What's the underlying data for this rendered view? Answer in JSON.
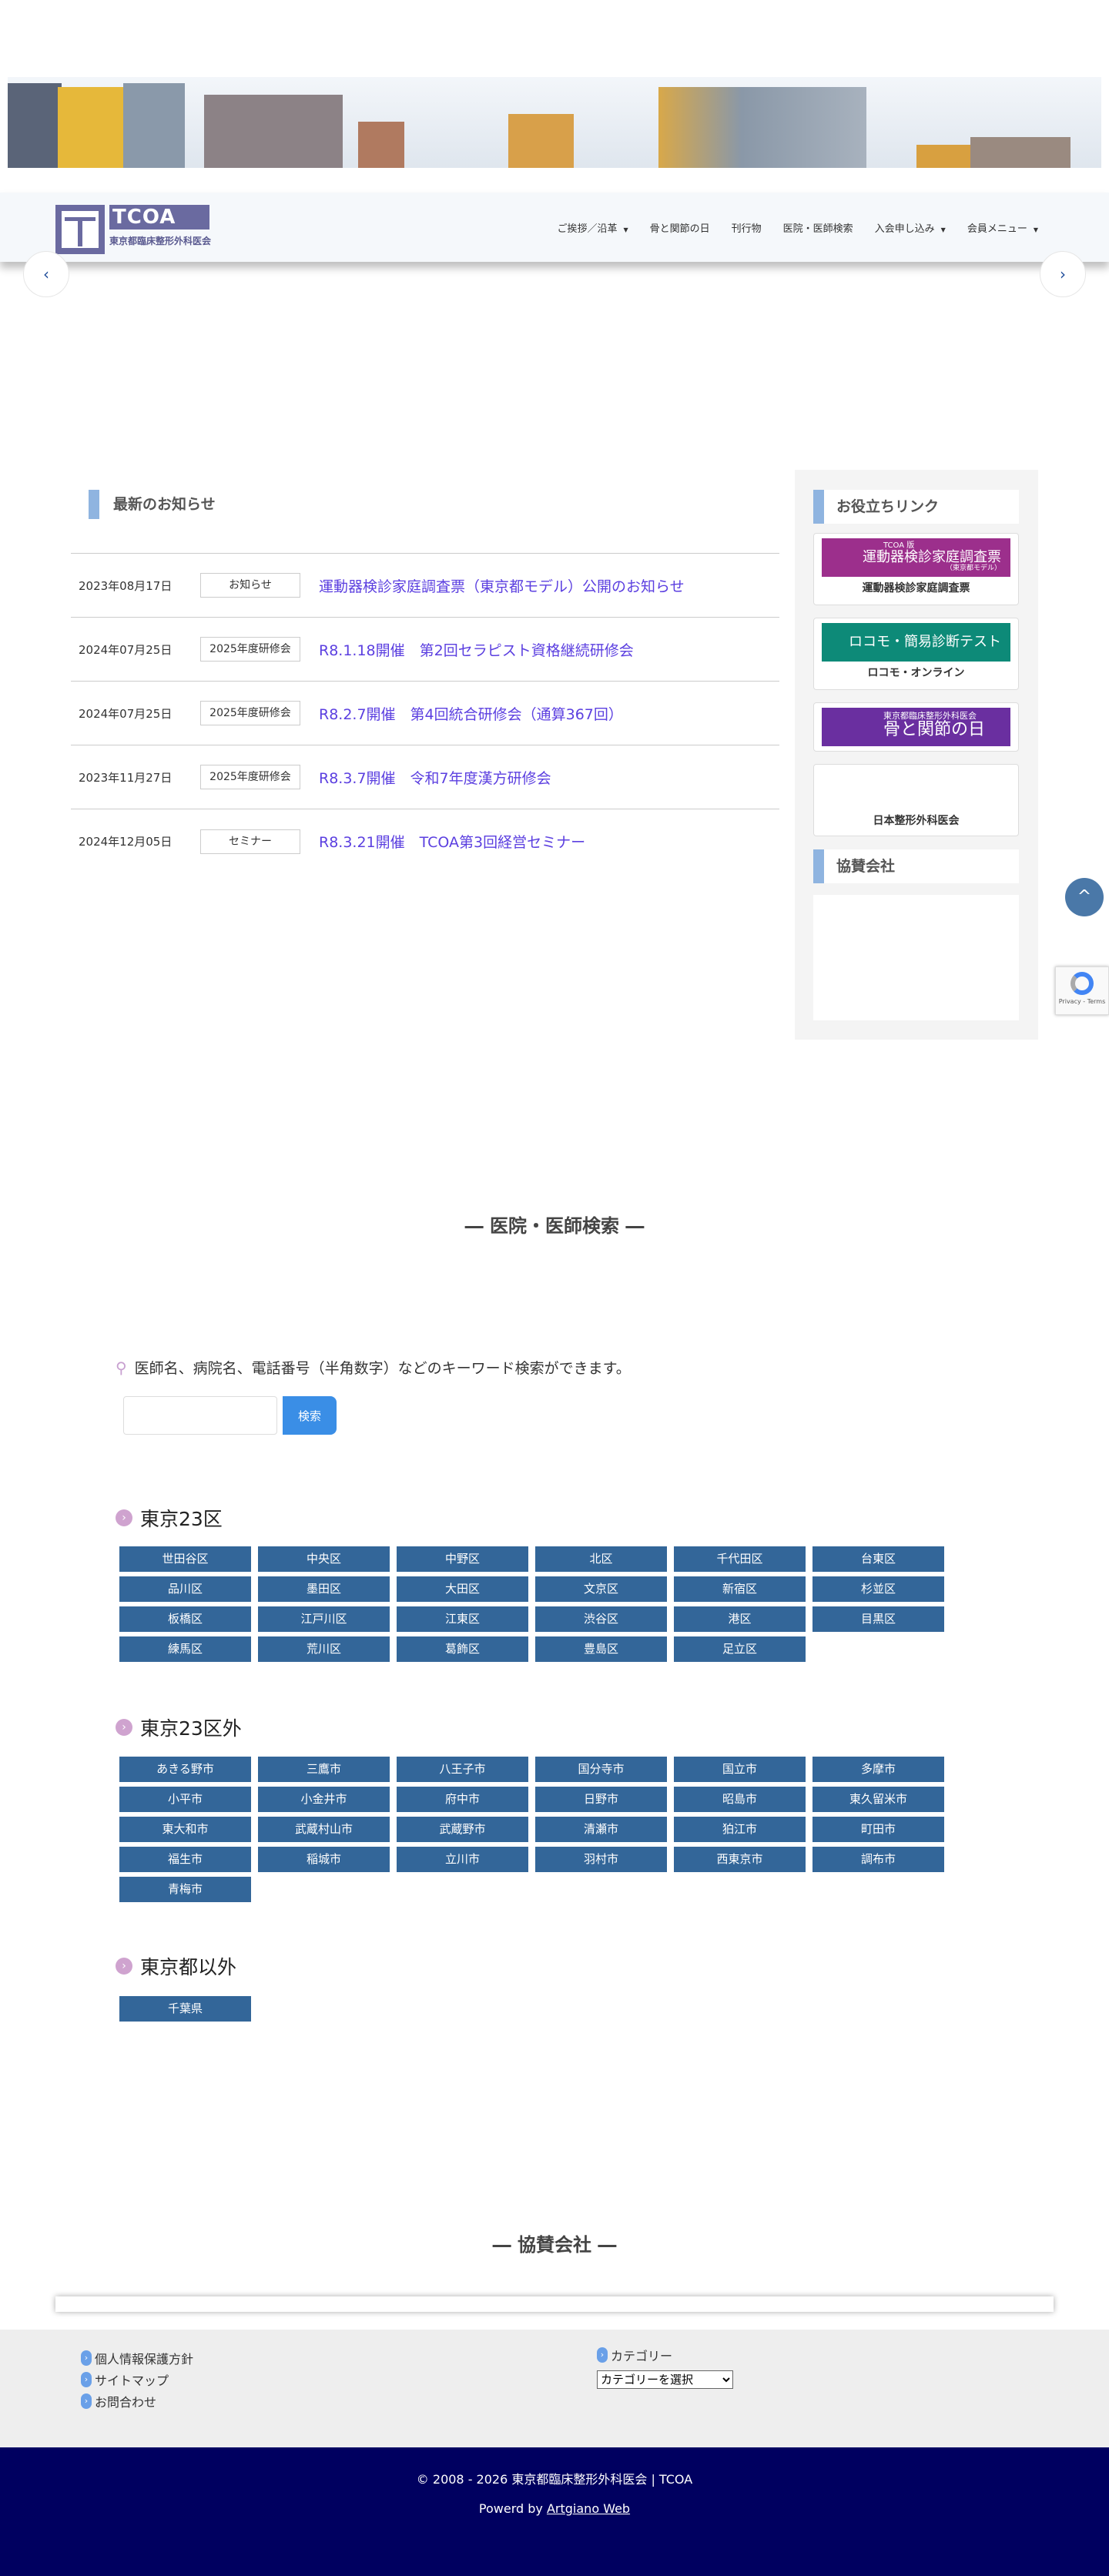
{
  "header": {
    "logo_text": "TCOA",
    "logo_sub": "東京都臨床整形外科医会",
    "nav": [
      {
        "label": "ご挨拶／沿革",
        "dropdown": true
      },
      {
        "label": "骨と関節の日",
        "dropdown": false
      },
      {
        "label": "刊行物",
        "dropdown": false
      },
      {
        "label": "医院・医師検索",
        "dropdown": false
      },
      {
        "label": "入会申し込み",
        "dropdown": true
      },
      {
        "label": "会員メニュー",
        "dropdown": true
      }
    ],
    "caret": "▼"
  },
  "slider": {
    "prev": "‹",
    "next": "›"
  },
  "news": {
    "title": "最新のお知らせ",
    "items": [
      {
        "date": "2023年08月17日",
        "category": "お知らせ",
        "title": "運動器検診家庭調査票（東京都モデル）公開のお知らせ"
      },
      {
        "date": "2024年07月25日",
        "category": "2025年度研修会",
        "title": "R8.1.18開催　第2回セラピスト資格継続研修会"
      },
      {
        "date": "2024年07月25日",
        "category": "2025年度研修会",
        "title": "R8.2.7開催　第4回統合研修会（通算367回）"
      },
      {
        "date": "2023年11月27日",
        "category": "2025年度研修会",
        "title": "R8.3.7開催　令和7年度漢方研修会"
      },
      {
        "date": "2024年12月05日",
        "category": "セミナー",
        "title": "R8.3.21開催　TCOA第3回経営セミナー"
      }
    ]
  },
  "sidebar": {
    "links_title": "お役立ちリンク",
    "links": [
      {
        "banner": "運動器検診家庭調査票",
        "banner_top": "TCOA 版",
        "banner_sub": "（東京都モデル）",
        "caption": "運動器検診家庭調査票",
        "color": "#9c2f8c"
      },
      {
        "banner": "ロコモ・簡易診断テスト",
        "caption": "ロコモ・オンライン",
        "color": "#0d8a78"
      },
      {
        "banner": "骨と関節の日",
        "banner_top": "東京都臨床整形外科医会",
        "caption": "",
        "color": "#6a2fa0"
      },
      {
        "caption": "日本整形外科医会"
      }
    ],
    "sponsor_title": "協賛会社"
  },
  "totop": "^",
  "recaptcha": "Privacy - Terms",
  "search": {
    "heading": "― 医院・医師検索 ―",
    "description": "医師名、病院名、電話番号（半角数字）などのキーワード検索ができます。",
    "input_value": "",
    "button": "検索"
  },
  "areas": [
    {
      "title": "東京23区",
      "items": [
        "世田谷区",
        "中央区",
        "中野区",
        "北区",
        "千代田区",
        "台東区",
        "品川区",
        "墨田区",
        "大田区",
        "文京区",
        "新宿区",
        "杉並区",
        "板橋区",
        "江戸川区",
        "江東区",
        "渋谷区",
        "港区",
        "目黒区",
        "練馬区",
        "荒川区",
        "葛飾区",
        "豊島区",
        "足立区"
      ]
    },
    {
      "title": "東京23区外",
      "items": [
        "あきる野市",
        "三鷹市",
        "八王子市",
        "国分寺市",
        "国立市",
        "多摩市",
        "小平市",
        "小金井市",
        "府中市",
        "日野市",
        "昭島市",
        "東久留米市",
        "東大和市",
        "武蔵村山市",
        "武蔵野市",
        "清瀬市",
        "狛江市",
        "町田市",
        "福生市",
        "稲城市",
        "立川市",
        "羽村市",
        "西東京市",
        "調布市",
        "青梅市"
      ]
    },
    {
      "title": "東京都以外",
      "items": [
        "千葉県"
      ]
    }
  ],
  "sponsor": {
    "heading": "― 協賛会社 ―"
  },
  "footer": {
    "links": [
      "個人情報保護方針",
      "サイトマップ",
      "お問合わせ"
    ],
    "category_title": "カテゴリー",
    "category_select": "カテゴリーを選択",
    "copyright": "© 2008 - 2026 東京都臨床整形外科医会 | TCOA",
    "powered_prefix": "Powerd by ",
    "powered_link": "Artgiano Web"
  }
}
